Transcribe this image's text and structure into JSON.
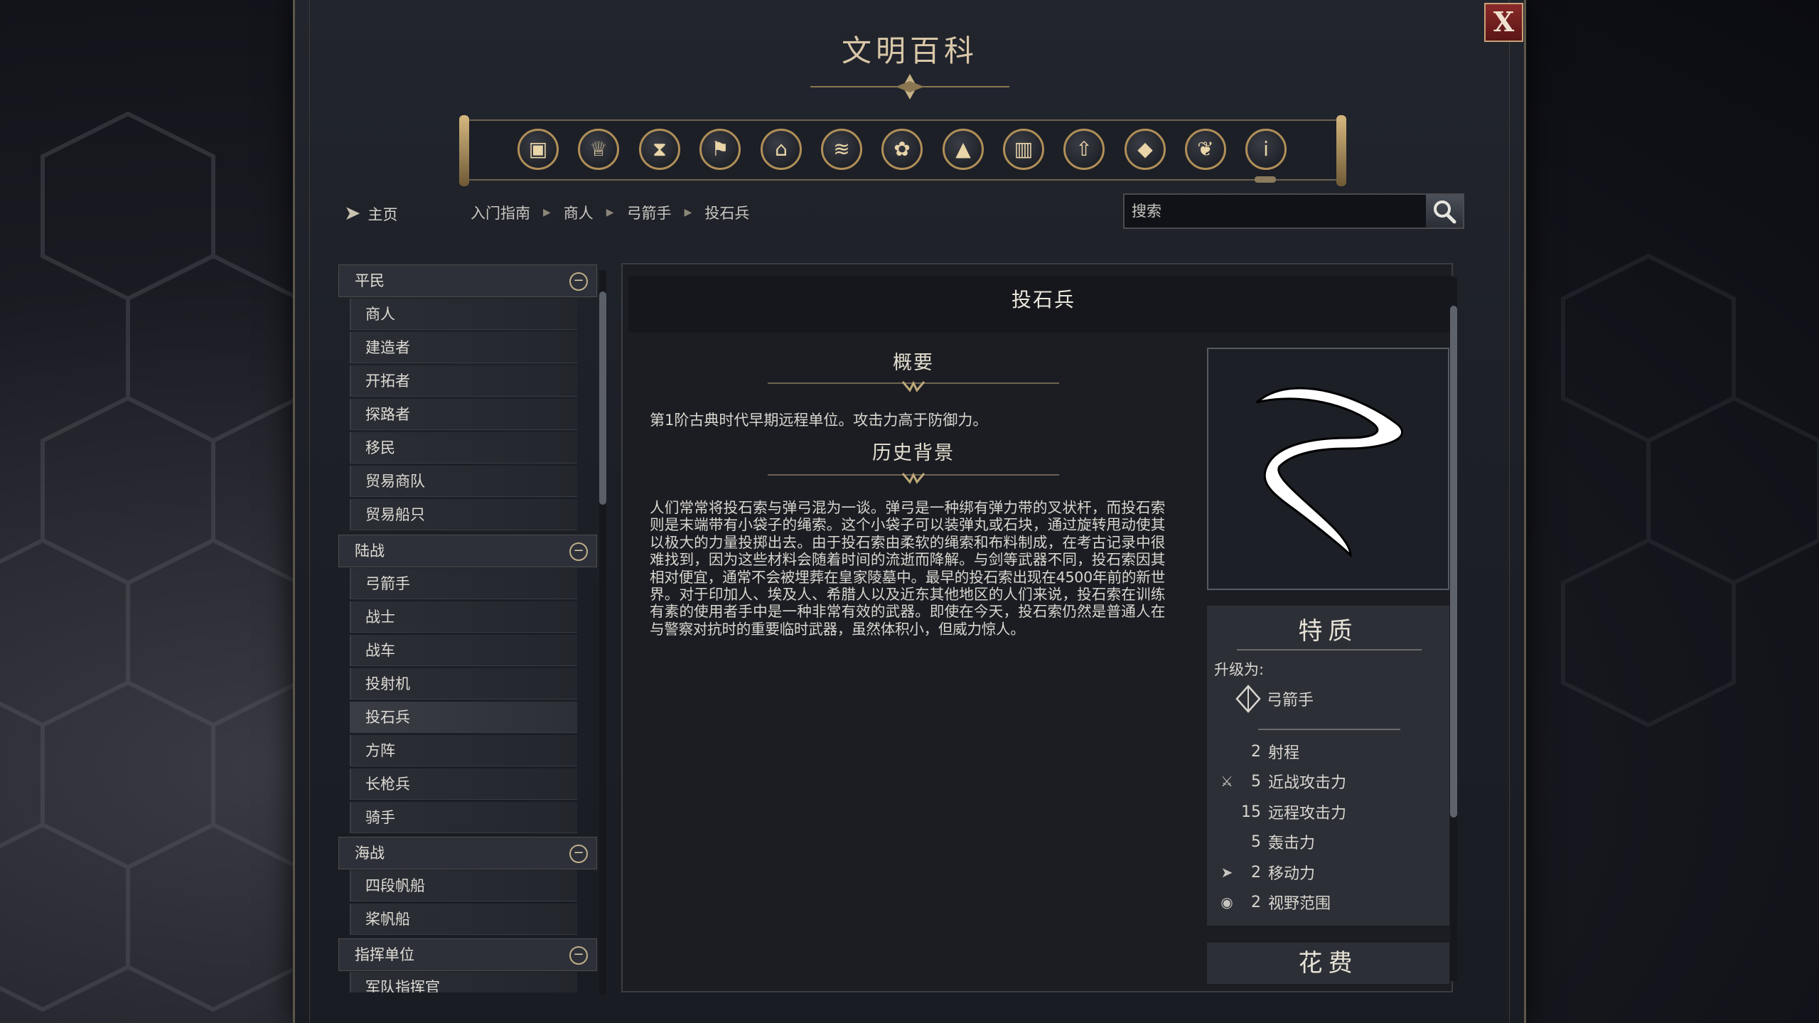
{
  "window": {
    "title": "文明百科",
    "close_label": "X"
  },
  "nav": {
    "home_label": "主页"
  },
  "categories": [
    {
      "icon": "unit-crate-icon"
    },
    {
      "icon": "cup-icon"
    },
    {
      "icon": "hourglass-icon"
    },
    {
      "icon": "flag-icon"
    },
    {
      "icon": "government-building-icon"
    },
    {
      "icon": "open-book-icon"
    },
    {
      "icon": "flower-icon"
    },
    {
      "icon": "mountain-icon"
    },
    {
      "icon": "city-icon"
    },
    {
      "icon": "upgrade-arrow-icon"
    },
    {
      "icon": "resource-icon"
    },
    {
      "icon": "dove-icon"
    },
    {
      "icon": "info-icon"
    }
  ],
  "breadcrumb": [
    "入门指南",
    "商人",
    "弓箭手",
    "投石兵"
  ],
  "search": {
    "placeholder": "搜索"
  },
  "sidebar": {
    "groups": [
      {
        "label": "平民",
        "items": [
          "商人",
          "建造者",
          "开拓者",
          "探路者",
          "移民",
          "贸易商队",
          "贸易船只"
        ]
      },
      {
        "label": "陆战",
        "items": [
          "弓箭手",
          "战士",
          "战车",
          "投射机",
          "投石兵",
          "方阵",
          "长枪兵",
          "骑手"
        ]
      },
      {
        "label": "海战",
        "items": [
          "四段帆船",
          "桨帆船"
        ]
      },
      {
        "label": "指挥单位",
        "items": [
          "军队指挥官"
        ]
      }
    ],
    "selected": "投石兵"
  },
  "article": {
    "title": "投石兵",
    "summary_heading": "概要",
    "summary": "第1阶古典时代早期远程单位。攻击力高于防御力。",
    "history_heading": "历史背景",
    "history": "人们常常将投石索与弹弓混为一谈。弹弓是一种绑有弹力带的叉状杆，而投石索则是末端带有小袋子的绳索。这个小袋子可以装弹丸或石块，通过旋转甩动使其以极大的力量投掷出去。由于投石索由柔软的绳索和布料制成，在考古记录中很难找到，因为这些材料会随着时间的流逝而降解。与剑等武器不同，投石索因其相对便宜，通常不会被埋葬在皇家陵墓中。最早的投石索出现在4500年前的新世界。对于印加人、埃及人、希腊人以及近东其他地区的人们来说，投石索在训练有素的使用者手中是一种非常有效的武器。即使在今天，投石索仍然是普通人在与警察对抗时的重要临时武器，虽然体积小，但威力惊人。"
  },
  "traits": {
    "heading": "特质",
    "upgrade_label": "升级为:",
    "upgrade_to": "弓箭手",
    "stats": [
      {
        "icon": "",
        "value": "2",
        "label": "射程"
      },
      {
        "icon": "sword-icon",
        "value": "5",
        "label": "近战攻击力"
      },
      {
        "icon": "",
        "value": "15",
        "label": "远程攻击力"
      },
      {
        "icon": "",
        "value": "5",
        "label": "轰击力"
      },
      {
        "icon": "movement-arrow-icon",
        "value": "2",
        "label": "移动力"
      },
      {
        "icon": "eye-icon",
        "value": "2",
        "label": "视野范围"
      }
    ]
  },
  "cost": {
    "heading": "花费"
  },
  "colors": {
    "accent_gold": "#b08f58",
    "close_red": "#7a1f1f",
    "panel_bg": "#1c1f26"
  }
}
